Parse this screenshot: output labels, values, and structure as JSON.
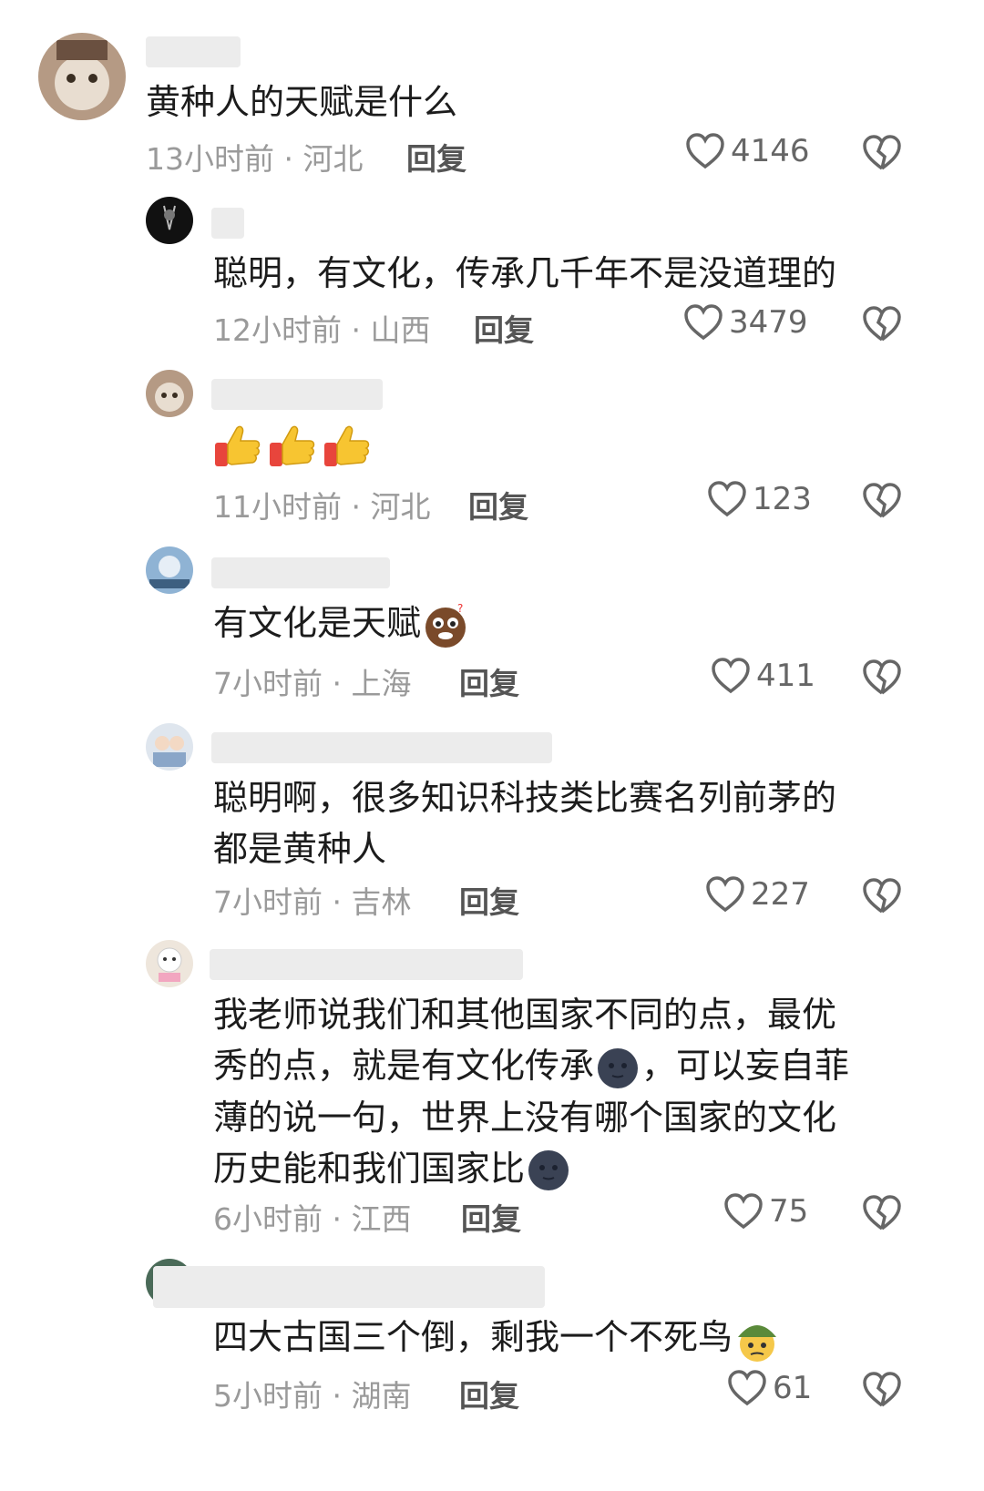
{
  "comments": [
    {
      "text": "黄种人的天赋是什么",
      "time": "13小时前",
      "location": "河北",
      "reply_label": "回复",
      "likes": "4146"
    },
    {
      "text": "聪明，有文化，传承几千年不是没道理的",
      "time": "12小时前",
      "location": "山西",
      "reply_label": "回复",
      "likes": "3479"
    },
    {
      "text": "",
      "emoji": [
        "thumbs-up",
        "thumbs-up",
        "thumbs-up"
      ],
      "time": "11小时前",
      "location": "河北",
      "reply_label": "回复",
      "likes": "123"
    },
    {
      "text": "有文化是天赋",
      "emoji": [
        "confused-face"
      ],
      "time": "7小时前",
      "location": "上海",
      "reply_label": "回复",
      "likes": "411"
    },
    {
      "text_lines": [
        "聪明啊，很多知识科技类比赛名列前茅的",
        "都是黄种人"
      ],
      "time": "7小时前",
      "location": "吉林",
      "reply_label": "回复",
      "likes": "227"
    },
    {
      "text_lines": [
        "我老师说我们和其他国家不同的点，最优",
        "秀的点，就是有文化传承",
        "，可以妄自菲",
        "薄的说一句，世界上没有哪个国家的文化",
        "历史能和我们国家比"
      ],
      "emoji": [
        "dark-moon-face",
        "dark-moon-face"
      ],
      "time": "6小时前",
      "location": "江西",
      "reply_label": "回复",
      "likes": "75"
    },
    {
      "text": "四大古国三个倒，剩我一个不死鸟",
      "emoji": [
        "soldier-face"
      ],
      "time": "5小时前",
      "location": "湖南",
      "reply_label": "回复",
      "likes": "61"
    }
  ],
  "meta_separator": " · ",
  "colors": {
    "meta": "#9a9a9a",
    "text": "#1c1c1c",
    "reply": "#555555",
    "heart": "#666666"
  }
}
